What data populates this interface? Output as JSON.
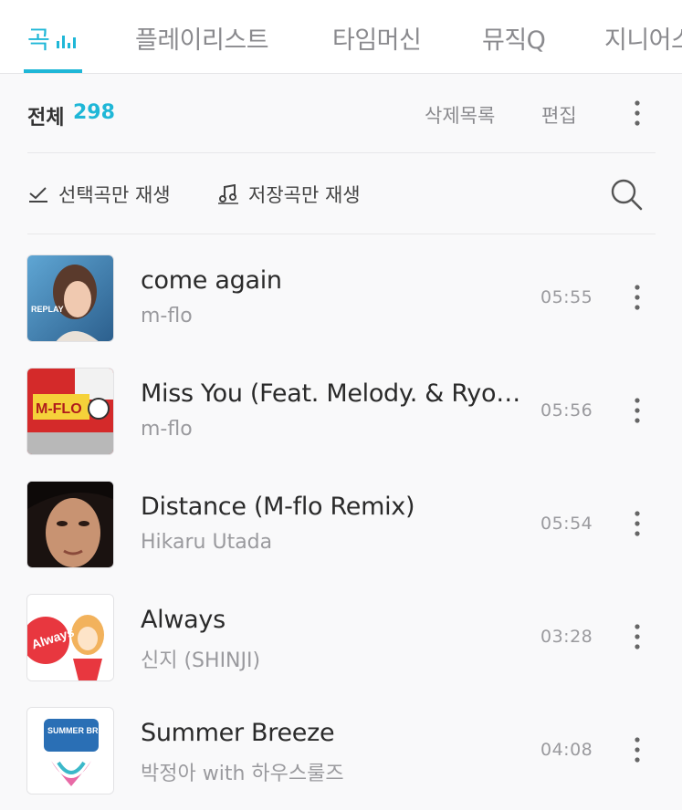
{
  "tabs": [
    {
      "label": "곡",
      "active": true
    },
    {
      "label": "플레이리스트",
      "active": false
    },
    {
      "label": "타임머신",
      "active": false
    },
    {
      "label": "뮤직Q",
      "active": false
    },
    {
      "label": "지니어스",
      "active": false
    }
  ],
  "summary": {
    "total_label": "전체",
    "total_count": "298",
    "delete_list": "삭제목록",
    "edit": "편집"
  },
  "filters": {
    "play_selected": "선택곡만 재생",
    "play_saved": "저장곡만 재생"
  },
  "songs": [
    {
      "title": "come again",
      "artist": "m-flo",
      "duration": "05:55",
      "cover_text": "REPLAY"
    },
    {
      "title": "Miss You (Feat. Melody. & Ryohei Yamamoto)",
      "artist": "m-flo",
      "duration": "05:56",
      "cover_text": "M-FLO"
    },
    {
      "title": "Distance (M-flo Remix)",
      "artist": "Hikaru Utada",
      "duration": "05:54",
      "cover_text": ""
    },
    {
      "title": "Always",
      "artist": "신지 (SHINJI)",
      "duration": "03:28",
      "cover_text": "Always"
    },
    {
      "title": "Summer Breeze",
      "artist": "박정아 with 하우스룰즈",
      "duration": "04:08",
      "cover_text": "SUMMER BREAK"
    }
  ],
  "colors": {
    "accent": "#1fb7d7",
    "background": "#f9f9fa",
    "muted": "#9a9a9e"
  },
  "icons": {
    "now_playing": "equalizer-icon",
    "more": "more-vertical-icon",
    "search": "search-icon",
    "checkmark": "check-select-icon",
    "music_note": "music-note-icon"
  }
}
